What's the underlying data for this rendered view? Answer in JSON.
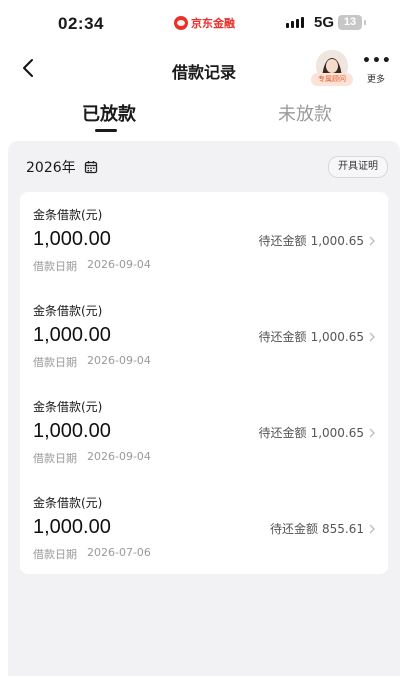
{
  "status_bar": {
    "time": "02:34",
    "brand": "京东金融",
    "network": "5G",
    "battery": "13"
  },
  "nav": {
    "title": "借款记录",
    "advisor_tag": "专属顾问",
    "more_label": "更多"
  },
  "tabs": [
    {
      "label": "已放款",
      "active": true
    },
    {
      "label": "未放款",
      "active": false
    }
  ],
  "filter": {
    "year": "2026年",
    "certificate_button": "开具证明"
  },
  "loans": [
    {
      "name": "金条借款(元)",
      "amount": "1,000.00",
      "date_label": "借款日期",
      "date": "2026-09-04",
      "due_label": "待还金额",
      "due_value": "1,000.65"
    },
    {
      "name": "金条借款(元)",
      "amount": "1,000.00",
      "date_label": "借款日期",
      "date": "2026-09-04",
      "due_label": "待还金额",
      "due_value": "1,000.65"
    },
    {
      "name": "金条借款(元)",
      "amount": "1,000.00",
      "date_label": "借款日期",
      "date": "2026-09-04",
      "due_label": "待还金额",
      "due_value": "1,000.65"
    },
    {
      "name": "金条借款(元)",
      "amount": "1,000.00",
      "date_label": "借款日期",
      "date": "2026-07-06",
      "due_label": "待还金额",
      "due_value": "855.61"
    }
  ],
  "colors": {
    "brand_red": "#e8312b",
    "panel_bg": "#f2f2f5",
    "muted_text": "#9a9a9a"
  }
}
